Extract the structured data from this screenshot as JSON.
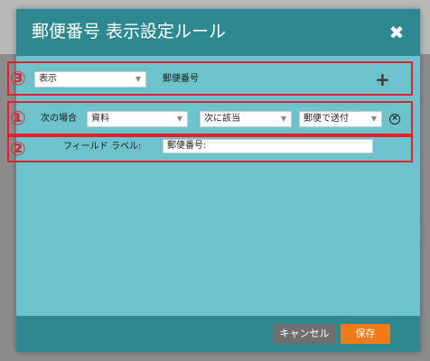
{
  "dialog": {
    "title": "郵便番号 表示設定ルール",
    "close_icon": "close-icon",
    "header_color": "#2e8890",
    "body_color": "#6cc3cb"
  },
  "annotations": {
    "one": "①",
    "two": "②",
    "three": "③",
    "highlight_color": "#e5202a"
  },
  "action_row": {
    "action_select": "表示",
    "target_label": "郵便番号",
    "add_icon": "plus-icon",
    "add_symbol": "+"
  },
  "condition_row": {
    "prefix_label": "次の場合",
    "field_select": "資料",
    "operator_select": "次に該当",
    "value_select": "郵便で送付",
    "remove_icon": "remove-circle-icon",
    "remove_symbol": "×"
  },
  "label_row": {
    "field_label_caption": "フィールド ラベル:",
    "field_label_value": "郵便番号:"
  },
  "footer": {
    "cancel_label": "キャンセル",
    "save_label": "保存",
    "save_color": "#f07b16"
  }
}
